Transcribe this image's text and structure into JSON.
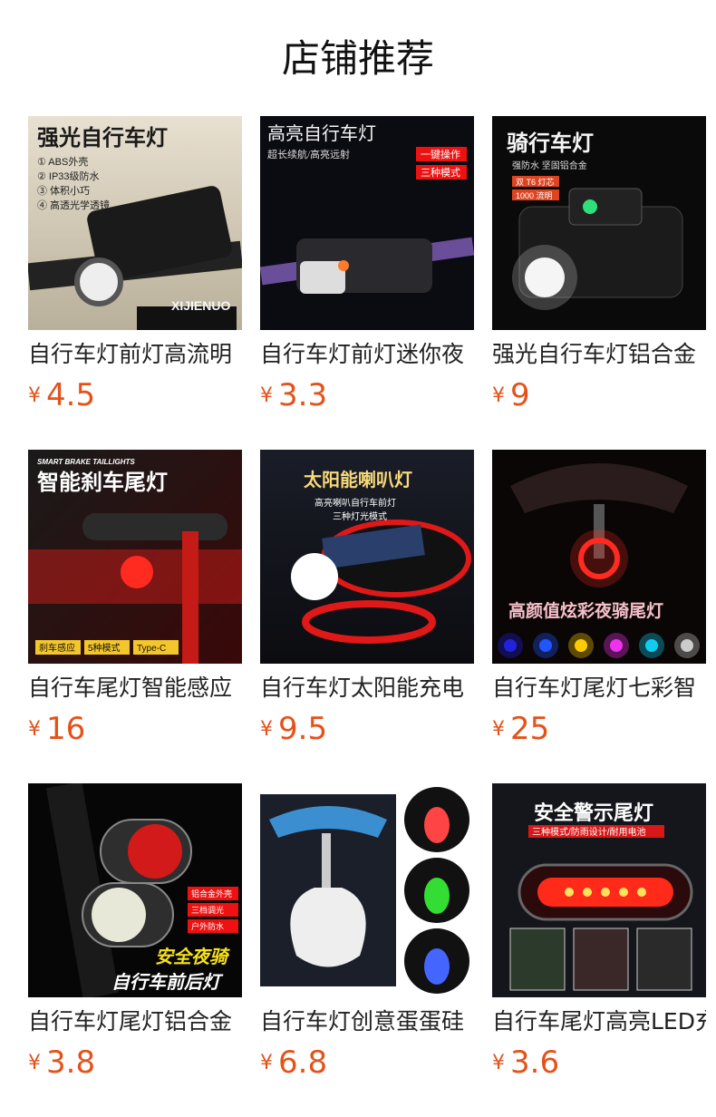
{
  "header": {
    "title": "店铺推荐"
  },
  "currency": "¥",
  "products": [
    {
      "title": "自行车灯前灯高流明",
      "price": "4.5",
      "image": {
        "headline": "强光自行车灯",
        "bullets": [
          "① ABS外壳",
          "② IP33级防水",
          "③ 体积小巧",
          "④ 高透光学透镜"
        ],
        "brand": "XIJIENUO",
        "icon": "bike-headlight-image"
      }
    },
    {
      "title": "自行车灯前灯迷你夜",
      "price": "3.3",
      "image": {
        "headline": "高亮自行车灯",
        "subline": "超长续航/高亮远射",
        "tags": [
          "一键操作",
          "三种模式"
        ],
        "icon": "bike-headlight-image"
      }
    },
    {
      "title": "强光自行车灯铝合金",
      "price": "9",
      "image": {
        "headline": "骑行车灯",
        "subline": "强防水 坚固铝合金",
        "tags": [
          "双 T6 灯芯",
          "1000 流明"
        ],
        "icon": "bike-headlight-image"
      }
    },
    {
      "title": "自行车尾灯智能感应",
      "price": "16",
      "image": {
        "topline": "SMART BRAKE TAILLIGHTS",
        "headline": "智能刹车尾灯",
        "tags": [
          "刹车感应",
          "5种模式",
          "Type-C"
        ],
        "icon": "taillight-image"
      }
    },
    {
      "title": "自行车灯太阳能充电",
      "price": "9.5",
      "image": {
        "headline": "太阳能喇叭灯",
        "lines": [
          "高亮喇叭自行车前灯",
          "三种灯光模式"
        ],
        "icon": "solar-horn-light-image"
      }
    },
    {
      "title": "自行车灯尾灯七彩智",
      "price": "25",
      "image": {
        "headline": "高颜值炫彩夜骑尾灯",
        "dot_colors": [
          "#22d",
          "#25f",
          "#fc0",
          "#e3e",
          "#1ce",
          "#ccc"
        ],
        "icon": "colorful-taillight-image"
      }
    },
    {
      "title": "自行车灯尾灯铝合金",
      "price": "3.8",
      "image": {
        "tags": [
          "铝合金外壳",
          "三档调光",
          "户外防水"
        ],
        "headline": "安全夜骑",
        "subline": "自行车前后灯",
        "icon": "front-rear-light-image"
      }
    },
    {
      "title": "自行车灯创意蛋蛋硅",
      "price": "6.8",
      "image": {
        "bulb_colors": [
          "#f44",
          "#3d3",
          "#46f"
        ],
        "icon": "egg-silicone-light-image"
      }
    },
    {
      "title": "自行车尾灯高亮LED充",
      "price": "3.6",
      "image": {
        "headline": "安全警示尾灯",
        "subline": "三种模式/防雨设计/耐用电池",
        "icon": "led-taillight-image"
      }
    }
  ]
}
